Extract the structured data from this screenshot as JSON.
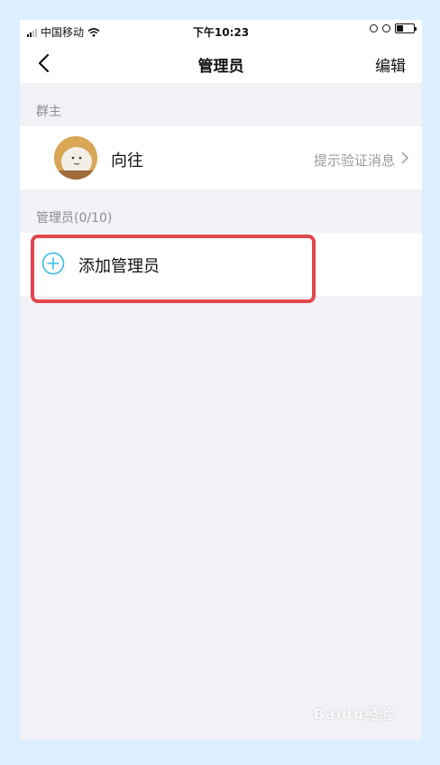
{
  "status_bar": {
    "carrier": "中国移动",
    "time": "下午10:23"
  },
  "nav": {
    "title": "管理员",
    "edit_label": "编辑",
    "back_icon": "chevron-left-icon"
  },
  "sections": {
    "owner_label": "群主",
    "admins_label": "管理员(0/10)"
  },
  "owner": {
    "name": "向往",
    "hint": "提示验证消息"
  },
  "add_admin": {
    "label": "添加管理员",
    "icon": "plus-circle-icon",
    "icon_color": "#3ab8e6"
  },
  "highlight_color": "#e2474b",
  "watermark": "Baidu经验"
}
